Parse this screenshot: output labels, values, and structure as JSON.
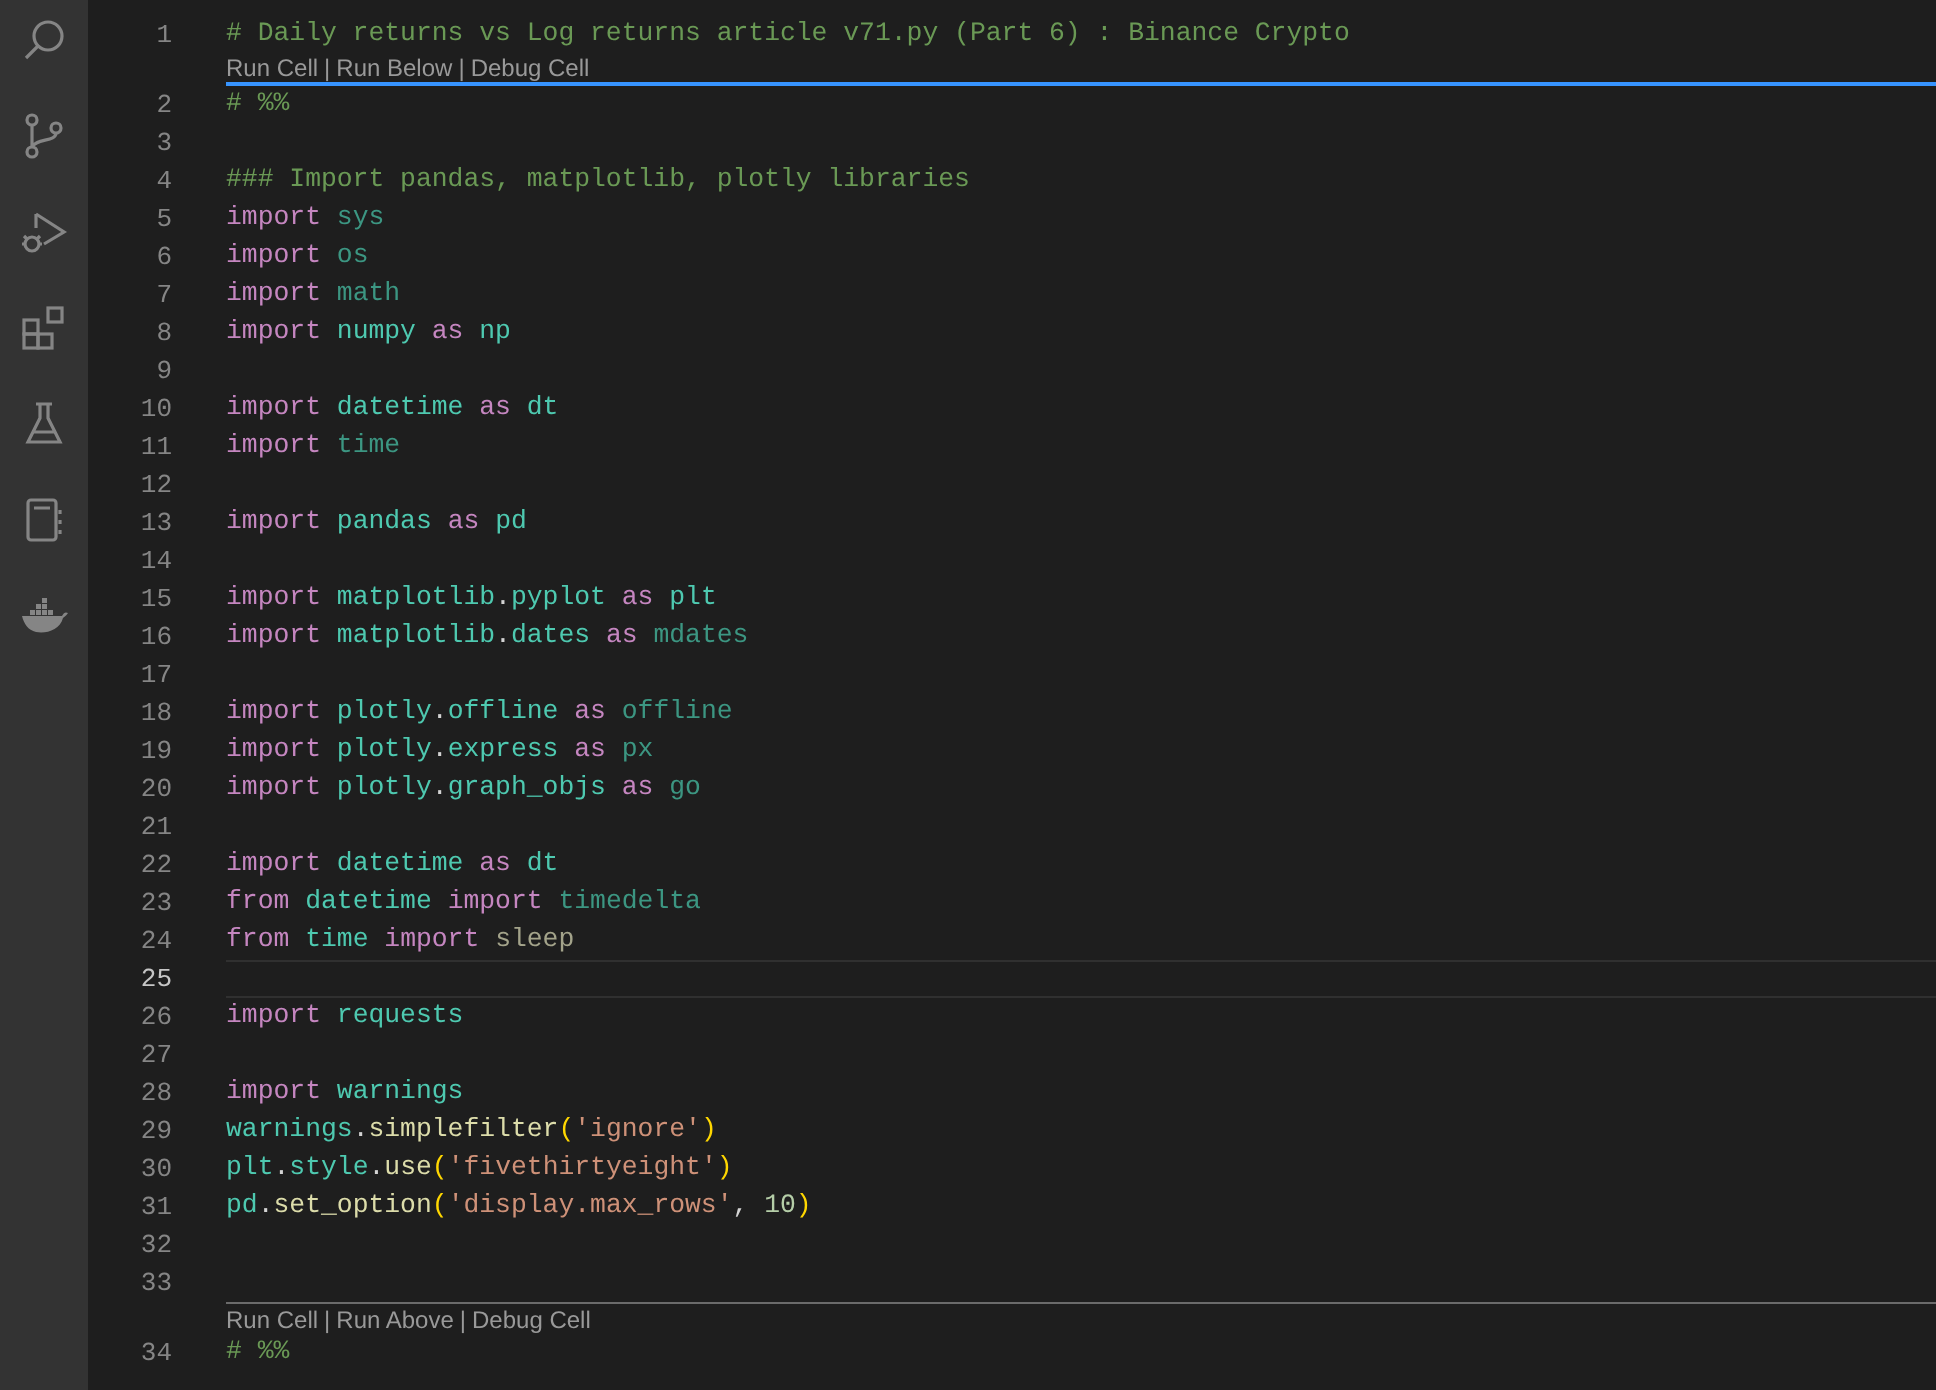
{
  "editor": {
    "codelens_separator": "|",
    "lines": [
      {
        "kind": "code",
        "number": "1",
        "current": false,
        "tokens": [
          {
            "kind": "comment",
            "text": "# Daily returns vs Log returns article v71.py (Part 6) : Binance Crypto"
          }
        ]
      },
      {
        "kind": "codelens",
        "active": true,
        "actions": [
          "Run Cell",
          "Run Below",
          "Debug Cell"
        ]
      },
      {
        "kind": "code",
        "number": "2",
        "current": false,
        "tokens": [
          {
            "kind": "comment",
            "text": "# %%"
          }
        ]
      },
      {
        "kind": "code",
        "number": "3",
        "current": false
      },
      {
        "kind": "code",
        "number": "4",
        "current": false,
        "tokens": [
          {
            "kind": "comment",
            "text": "### Import pandas, matplotlib, plotly libraries"
          }
        ]
      },
      {
        "kind": "code",
        "number": "5",
        "current": false,
        "tokens": [
          {
            "kind": "keyword",
            "text": "import "
          },
          {
            "kind": "unused",
            "text": "sys"
          }
        ]
      },
      {
        "kind": "code",
        "number": "6",
        "current": false,
        "tokens": [
          {
            "kind": "keyword",
            "text": "import "
          },
          {
            "kind": "unused",
            "text": "os"
          }
        ]
      },
      {
        "kind": "code",
        "number": "7",
        "current": false,
        "tokens": [
          {
            "kind": "keyword",
            "text": "import "
          },
          {
            "kind": "unused",
            "text": "math"
          }
        ]
      },
      {
        "kind": "code",
        "number": "8",
        "current": false,
        "tokens": [
          {
            "kind": "keyword",
            "text": "import "
          },
          {
            "kind": "module",
            "text": "numpy "
          },
          {
            "kind": "keyword",
            "text": "as "
          },
          {
            "kind": "module",
            "text": "np"
          }
        ]
      },
      {
        "kind": "code",
        "number": "9",
        "current": false
      },
      {
        "kind": "code",
        "number": "10",
        "current": false,
        "tokens": [
          {
            "kind": "keyword",
            "text": "import "
          },
          {
            "kind": "module",
            "text": "datetime "
          },
          {
            "kind": "keyword",
            "text": "as "
          },
          {
            "kind": "module",
            "text": "dt"
          }
        ]
      },
      {
        "kind": "code",
        "number": "11",
        "current": false,
        "tokens": [
          {
            "kind": "keyword",
            "text": "import "
          },
          {
            "kind": "unused",
            "text": "time"
          }
        ]
      },
      {
        "kind": "code",
        "number": "12",
        "current": false
      },
      {
        "kind": "code",
        "number": "13",
        "current": false,
        "tokens": [
          {
            "kind": "keyword",
            "text": "import "
          },
          {
            "kind": "module",
            "text": "pandas "
          },
          {
            "kind": "keyword",
            "text": "as "
          },
          {
            "kind": "module",
            "text": "pd"
          }
        ]
      },
      {
        "kind": "code",
        "number": "14",
        "current": false
      },
      {
        "kind": "code",
        "number": "15",
        "current": false,
        "tokens": [
          {
            "kind": "keyword",
            "text": "import "
          },
          {
            "kind": "module",
            "text": "matplotlib"
          },
          {
            "kind": "plain",
            "text": "."
          },
          {
            "kind": "module",
            "text": "pyplot "
          },
          {
            "kind": "keyword",
            "text": "as "
          },
          {
            "kind": "module",
            "text": "plt"
          }
        ]
      },
      {
        "kind": "code",
        "number": "16",
        "current": false,
        "tokens": [
          {
            "kind": "keyword",
            "text": "import "
          },
          {
            "kind": "module",
            "text": "matplotlib"
          },
          {
            "kind": "plain",
            "text": "."
          },
          {
            "kind": "module",
            "text": "dates "
          },
          {
            "kind": "keyword",
            "text": "as "
          },
          {
            "kind": "unused",
            "text": "mdates"
          }
        ]
      },
      {
        "kind": "code",
        "number": "17",
        "current": false
      },
      {
        "kind": "code",
        "number": "18",
        "current": false,
        "tokens": [
          {
            "kind": "keyword",
            "text": "import "
          },
          {
            "kind": "module",
            "text": "plotly"
          },
          {
            "kind": "plain",
            "text": "."
          },
          {
            "kind": "module",
            "text": "offline "
          },
          {
            "kind": "keyword",
            "text": "as "
          },
          {
            "kind": "unused",
            "text": "offline"
          }
        ]
      },
      {
        "kind": "code",
        "number": "19",
        "current": false,
        "tokens": [
          {
            "kind": "keyword",
            "text": "import "
          },
          {
            "kind": "module",
            "text": "plotly"
          },
          {
            "kind": "plain",
            "text": "."
          },
          {
            "kind": "module",
            "text": "express "
          },
          {
            "kind": "keyword",
            "text": "as "
          },
          {
            "kind": "unused",
            "text": "px"
          }
        ]
      },
      {
        "kind": "code",
        "number": "20",
        "current": false,
        "tokens": [
          {
            "kind": "keyword",
            "text": "import "
          },
          {
            "kind": "module",
            "text": "plotly"
          },
          {
            "kind": "plain",
            "text": "."
          },
          {
            "kind": "module",
            "text": "graph_objs "
          },
          {
            "kind": "keyword",
            "text": "as "
          },
          {
            "kind": "unused",
            "text": "go"
          }
        ]
      },
      {
        "kind": "code",
        "number": "21",
        "current": false
      },
      {
        "kind": "code",
        "number": "22",
        "current": false,
        "tokens": [
          {
            "kind": "keyword",
            "text": "import "
          },
          {
            "kind": "module",
            "text": "datetime "
          },
          {
            "kind": "keyword",
            "text": "as "
          },
          {
            "kind": "module",
            "text": "dt"
          }
        ]
      },
      {
        "kind": "code",
        "number": "23",
        "current": false,
        "tokens": [
          {
            "kind": "keyword",
            "text": "from "
          },
          {
            "kind": "module",
            "text": "datetime "
          },
          {
            "kind": "keyword",
            "text": "import "
          },
          {
            "kind": "unused",
            "text": "timedelta"
          }
        ]
      },
      {
        "kind": "code",
        "number": "24",
        "current": false,
        "tokens": [
          {
            "kind": "keyword",
            "text": "from "
          },
          {
            "kind": "module",
            "text": "time "
          },
          {
            "kind": "keyword",
            "text": "import "
          },
          {
            "kind": "unused_function",
            "text": "sleep"
          }
        ]
      },
      {
        "kind": "code",
        "number": "25",
        "current": true
      },
      {
        "kind": "code",
        "number": "26",
        "current": false,
        "tokens": [
          {
            "kind": "keyword",
            "text": "import "
          },
          {
            "kind": "module",
            "text": "requests"
          }
        ]
      },
      {
        "kind": "code",
        "number": "27",
        "current": false
      },
      {
        "kind": "code",
        "number": "28",
        "current": false,
        "tokens": [
          {
            "kind": "keyword",
            "text": "import "
          },
          {
            "kind": "module",
            "text": "warnings"
          }
        ]
      },
      {
        "kind": "code",
        "number": "29",
        "current": false,
        "tokens": [
          {
            "kind": "module",
            "text": "warnings"
          },
          {
            "kind": "plain",
            "text": "."
          },
          {
            "kind": "function",
            "text": "simplefilter"
          },
          {
            "kind": "bracket",
            "text": "("
          },
          {
            "kind": "string",
            "text": "'ignore'"
          },
          {
            "kind": "bracket",
            "text": ")"
          }
        ]
      },
      {
        "kind": "code",
        "number": "30",
        "current": false,
        "tokens": [
          {
            "kind": "module",
            "text": "plt"
          },
          {
            "kind": "plain",
            "text": "."
          },
          {
            "kind": "module",
            "text": "style"
          },
          {
            "kind": "plain",
            "text": "."
          },
          {
            "kind": "function",
            "text": "use"
          },
          {
            "kind": "bracket",
            "text": "("
          },
          {
            "kind": "string",
            "text": "'fivethirtyeight'"
          },
          {
            "kind": "bracket",
            "text": ")"
          }
        ]
      },
      {
        "kind": "code",
        "number": "31",
        "current": false,
        "tokens": [
          {
            "kind": "module",
            "text": "pd"
          },
          {
            "kind": "plain",
            "text": "."
          },
          {
            "kind": "function",
            "text": "set_option"
          },
          {
            "kind": "bracket",
            "text": "("
          },
          {
            "kind": "string",
            "text": "'display.max_rows'"
          },
          {
            "kind": "plain",
            "text": ", "
          },
          {
            "kind": "number",
            "text": "10"
          },
          {
            "kind": "bracket",
            "text": ")"
          }
        ]
      },
      {
        "kind": "code",
        "number": "32",
        "current": false
      },
      {
        "kind": "code",
        "number": "33",
        "current": false
      },
      {
        "kind": "codelens",
        "active": false,
        "actions": [
          "Run Cell",
          "Run Above",
          "Debug Cell"
        ]
      },
      {
        "kind": "code",
        "number": "34",
        "current": false,
        "tokens": [
          {
            "kind": "comment",
            "text": "# %%"
          }
        ]
      }
    ]
  }
}
